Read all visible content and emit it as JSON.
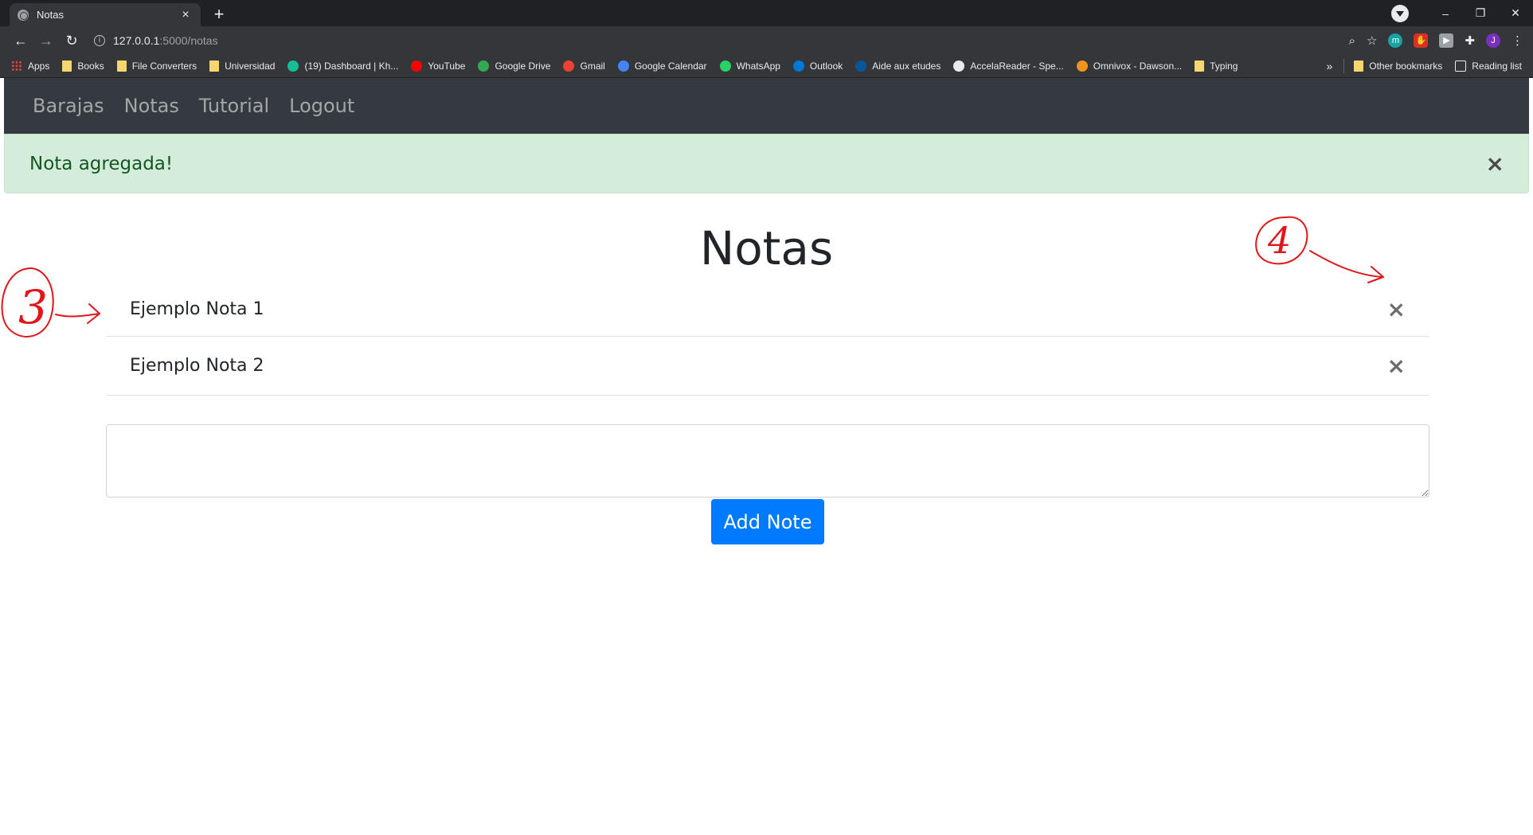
{
  "browser": {
    "tab_title": "Notas",
    "tab_close": "×",
    "new_tab": "+",
    "url_host": "127.0.0.1",
    "url_path": ":5000/notas",
    "profile_initial": "J",
    "win_minimize": "–",
    "win_restore": "❐",
    "win_close": "✕"
  },
  "bookmarks": {
    "items": [
      {
        "label": "Apps",
        "icon": "apps-grid-icon"
      },
      {
        "label": "Books",
        "icon": "folder-icon"
      },
      {
        "label": "File Converters",
        "icon": "folder-icon"
      },
      {
        "label": "Universidad",
        "icon": "folder-icon"
      },
      {
        "label": "(19) Dashboard | Kh...",
        "icon": "khan-icon",
        "color": "#14bf96"
      },
      {
        "label": "YouTube",
        "icon": "youtube-icon",
        "color": "#ff0000"
      },
      {
        "label": "Google Drive",
        "icon": "drive-icon",
        "color": "#34a853"
      },
      {
        "label": "Gmail",
        "icon": "gmail-icon",
        "color": "#ea4335"
      },
      {
        "label": "Google Calendar",
        "icon": "calendar-icon",
        "color": "#4285f4"
      },
      {
        "label": "WhatsApp",
        "icon": "whatsapp-icon",
        "color": "#25d366"
      },
      {
        "label": "Outlook",
        "icon": "outlook-icon",
        "color": "#0078d4"
      },
      {
        "label": "Aide aux etudes",
        "icon": "quebec-icon",
        "color": "#095797"
      },
      {
        "label": "AccelaReader - Spe...",
        "icon": "accelareader-icon",
        "color": "#e8eaed"
      },
      {
        "label": "Omnivox - Dawson...",
        "icon": "omnivox-icon",
        "color": "#f29222"
      },
      {
        "label": "Typing",
        "icon": "folder-icon"
      }
    ],
    "more": "»",
    "other": "Other bookmarks",
    "reading_list": "Reading list"
  },
  "navbar": {
    "links": [
      "Barajas",
      "Notas",
      "Tutorial",
      "Logout"
    ]
  },
  "alert": {
    "message": "Nota agregada!",
    "close": "×",
    "colors": {
      "bg": "#d4edda",
      "text": "#155724"
    }
  },
  "main": {
    "title": "Notas",
    "notes": [
      {
        "text": "Ejemplo Nota 1",
        "close": "×"
      },
      {
        "text": "Ejemplo Nota 2",
        "close": "×"
      }
    ],
    "textarea_value": "",
    "add_button": "Add Note",
    "accent": "#007bff"
  },
  "annotations": {
    "labels": [
      "3",
      "4"
    ],
    "color": "#e0161b"
  }
}
